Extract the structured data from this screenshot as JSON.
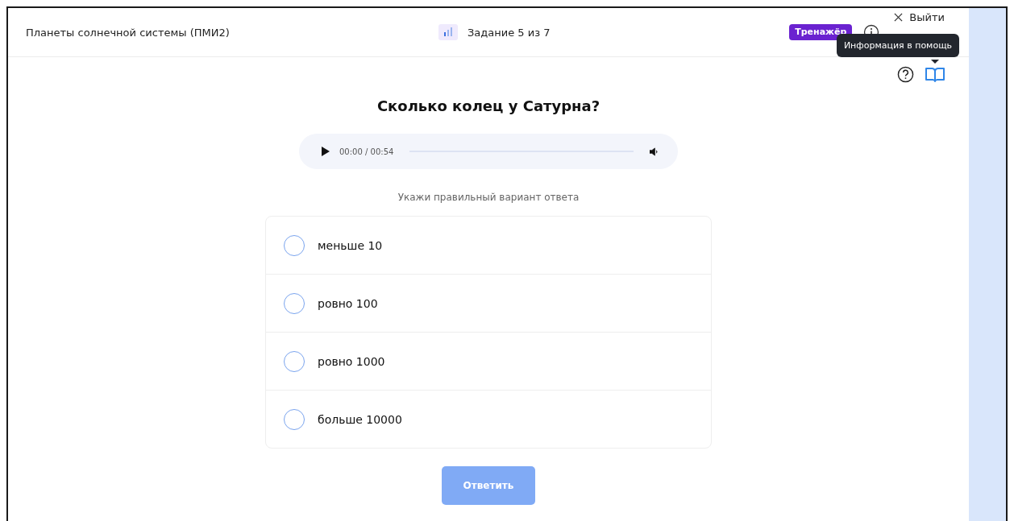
{
  "header": {
    "title": "Планеты солнечной системы (ПМИ2)",
    "progress": "Задание 5 из 7",
    "badge": "Тренажёр",
    "exit": "Выйти"
  },
  "tooltip": "Информация в помощь",
  "question": "Сколько колец у Сатурна?",
  "audio": {
    "time": "00:00 / 00:54"
  },
  "instruction": "Укажи правильный вариант ответа",
  "options": [
    {
      "label": "меньше 10",
      "selected": false
    },
    {
      "label": "ровно 100",
      "selected": false
    },
    {
      "label": "ровно 1000",
      "selected": false
    },
    {
      "label": "больше 10000",
      "selected": false
    }
  ],
  "submit": {
    "label": "Ответить",
    "disabled": true
  }
}
